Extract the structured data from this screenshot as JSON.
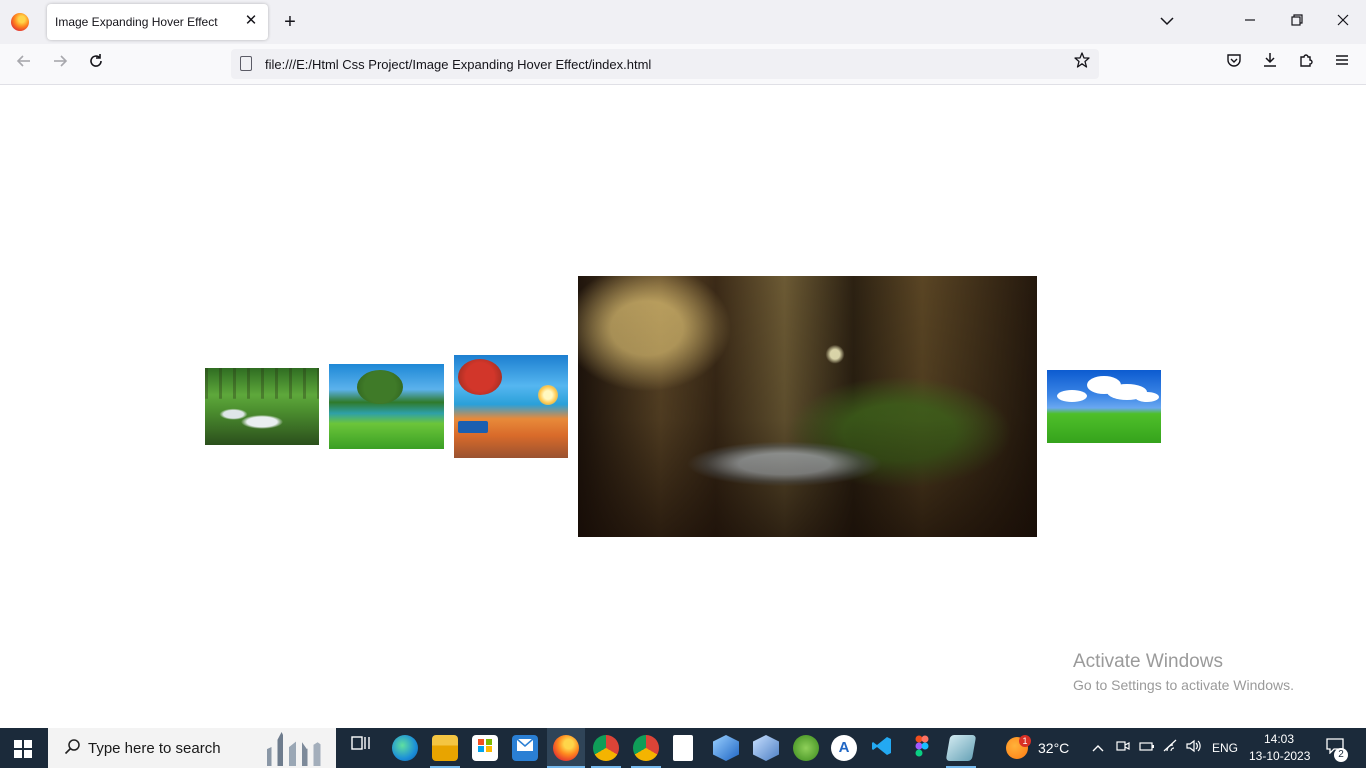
{
  "browser": {
    "tab_title": "Image Expanding Hover Effect",
    "tab_close": "✕",
    "new_tab": "+",
    "url": "file:///E:/Html Css Project/Image Expanding Hover Effect/index.html",
    "icons": [
      "firefox-icon",
      "back-icon",
      "forward-icon",
      "reload-icon",
      "page-icon",
      "star-icon",
      "pocket-icon",
      "download-icon",
      "extensions-icon",
      "menu-icon",
      "tab-list-icon",
      "minimize-icon",
      "restore-icon",
      "close-icon"
    ]
  },
  "gallery": {
    "images": [
      "forest-stream",
      "green-lake-tree",
      "autumn-park-sunset",
      "blurred-forest-creek",
      "green-hill-blue-sky"
    ],
    "expanded_index": 3
  },
  "watermark": {
    "title": "Activate Windows",
    "subtitle": "Go to Settings to activate Windows."
  },
  "taskbar": {
    "search_placeholder": "Type here to search",
    "weather_temp": "32°C",
    "weather_badge": "1",
    "language": "ENG",
    "time": "14:03",
    "date": "13-10-2023",
    "notification_count": "2",
    "apps": [
      "task-view",
      "edge",
      "file-explorer",
      "store",
      "mail",
      "firefox",
      "chrome",
      "chrome-profile",
      "notepad",
      "virtualbox",
      "virtualbox-2",
      "spring-tool",
      "app-a",
      "vscode",
      "figma",
      "editor"
    ]
  }
}
